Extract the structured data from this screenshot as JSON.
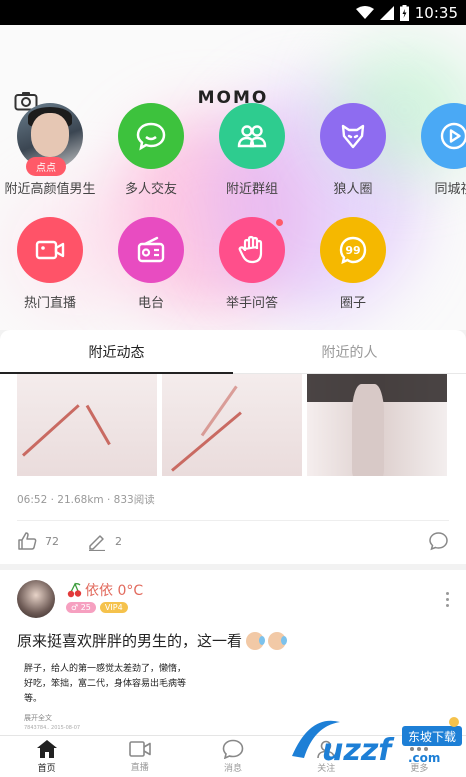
{
  "status_bar": {
    "time": "10:35"
  },
  "header": {
    "logo": "MOMO"
  },
  "shortcuts": [
    {
      "label": "附近高颜值男生",
      "badge": "点点",
      "icon": "avatar",
      "color": "#6b7f8e"
    },
    {
      "label": "多人交友",
      "icon": "chat-smile-icon",
      "color": "#3dc23d"
    },
    {
      "label": "附近群组",
      "icon": "group-icon",
      "color": "#2ecc8f"
    },
    {
      "label": "狼人圈",
      "icon": "wolf-icon",
      "color": "#8e6cf0"
    },
    {
      "label": "同城视",
      "icon": "play-icon",
      "color": "#4aa9f5"
    },
    {
      "label": "热门直播",
      "icon": "video-camera-icon",
      "color": "#ff5368"
    },
    {
      "label": "电台",
      "icon": "radio-icon",
      "color": "#e84cc1"
    },
    {
      "label": "举手问答",
      "icon": "raise-hand-icon",
      "color": "#ff4f8b"
    },
    {
      "label": "圈子",
      "icon": "circle-99-icon",
      "color": "#f5b800"
    }
  ],
  "tabs": [
    {
      "label": "附近动态",
      "active": true
    },
    {
      "label": "附近的人",
      "active": false
    }
  ],
  "feed_item_1": {
    "time": "06:52",
    "distance": "21.68km",
    "reads": "833阅读",
    "likes": "72",
    "comments": "2"
  },
  "feed_item_2": {
    "username": "依依 0°C",
    "tags": [
      "♂ 25",
      "VIP4"
    ],
    "title": "原来挺喜欢胖胖的男生的，这一看",
    "body_lines": [
      "胖子，给人的第一感觉太差劲了，懒惰，",
      "好吃，笨拙，富二代，身体容易出毛病等",
      "等。"
    ],
    "more": "展开全文",
    "footer": "7843784.. 2015-08-07"
  },
  "bottom_nav": [
    {
      "label": "首页",
      "icon": "home-icon",
      "active": true
    },
    {
      "label": "直播",
      "icon": "video-icon",
      "active": false
    },
    {
      "label": "消息",
      "icon": "message-icon",
      "active": false
    },
    {
      "label": "关注",
      "icon": "follow-icon",
      "active": false
    },
    {
      "label": "更多",
      "icon": "more-icon",
      "active": false
    }
  ],
  "watermark": {
    "text": "uzzf",
    "sub": "东坡下载",
    "domain": ".com"
  }
}
